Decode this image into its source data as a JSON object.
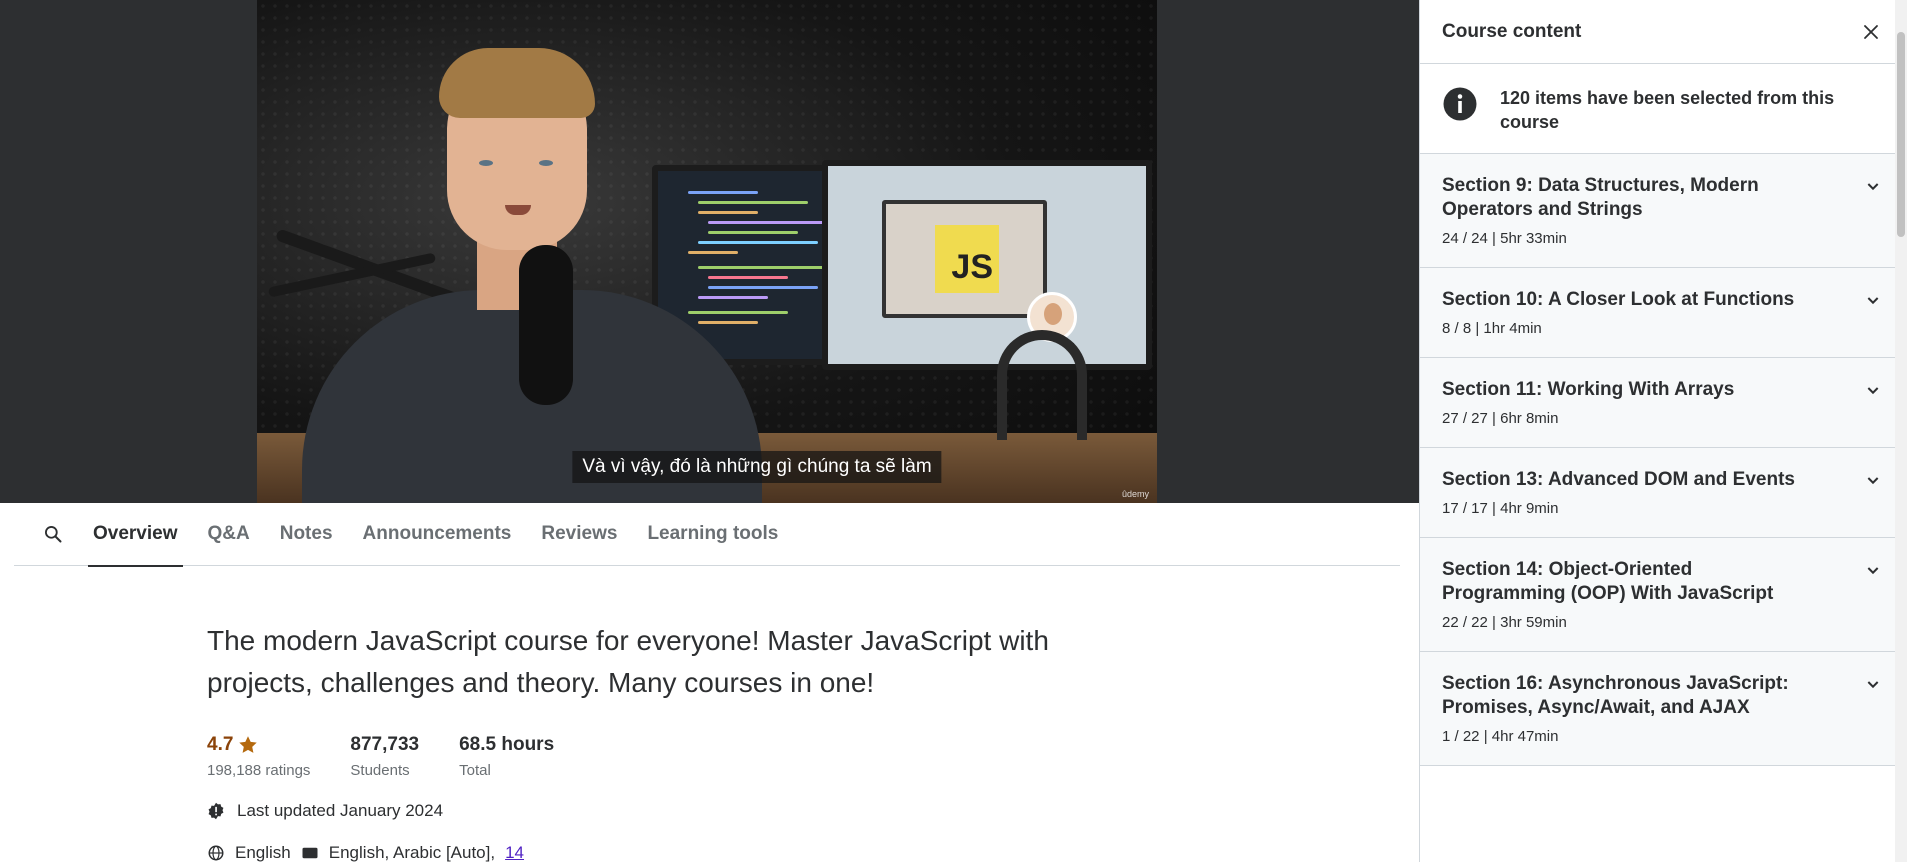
{
  "video": {
    "subtitle": "Và vì vậy, đó là những gì chúng ta sẽ làm",
    "watermark": "ûdemy",
    "badge_text": "JS"
  },
  "tabs": [
    {
      "label": "Overview",
      "active": true
    },
    {
      "label": "Q&A"
    },
    {
      "label": "Notes"
    },
    {
      "label": "Announcements"
    },
    {
      "label": "Reviews"
    },
    {
      "label": "Learning tools"
    }
  ],
  "overview": {
    "headline": "The modern JavaScript course for everyone! Master JavaScript with projects, challenges and theory. Many courses in one!",
    "rating": {
      "value": "4.7",
      "label": "198,188 ratings"
    },
    "students": {
      "value": "877,733",
      "label": "Students"
    },
    "total": {
      "value": "68.5 hours",
      "label": "Total"
    },
    "last_updated": "Last updated January 2024",
    "language": "English",
    "captions": "English, Arabic [Auto],",
    "captions_more": "14"
  },
  "sidebar": {
    "title": "Course content",
    "info": "120 items have been selected from this course",
    "sections": [
      {
        "title": "Section 9: Data Structures, Modern Operators and Strings",
        "meta": "24 / 24 | 5hr 33min"
      },
      {
        "title": "Section 10: A Closer Look at Functions",
        "meta": "8 / 8 | 1hr 4min"
      },
      {
        "title": "Section 11: Working With Arrays",
        "meta": "27 / 27 | 6hr 8min"
      },
      {
        "title": "Section 13: Advanced DOM and Events",
        "meta": "17 / 17 | 4hr 9min"
      },
      {
        "title": "Section 14: Object-Oriented Programming (OOP) With JavaScript",
        "meta": "22 / 22 | 3hr 59min"
      },
      {
        "title": "Section 16: Asynchronous JavaScript: Promises, Async/Await, and AJAX",
        "meta": "1 / 22 | 4hr 47min"
      }
    ]
  },
  "colors": {
    "accent_text": "#2d2f31",
    "rating": "#8b4309",
    "star": "#b4690e",
    "link": "#5022c3",
    "js_yellow": "#f0db4f"
  }
}
